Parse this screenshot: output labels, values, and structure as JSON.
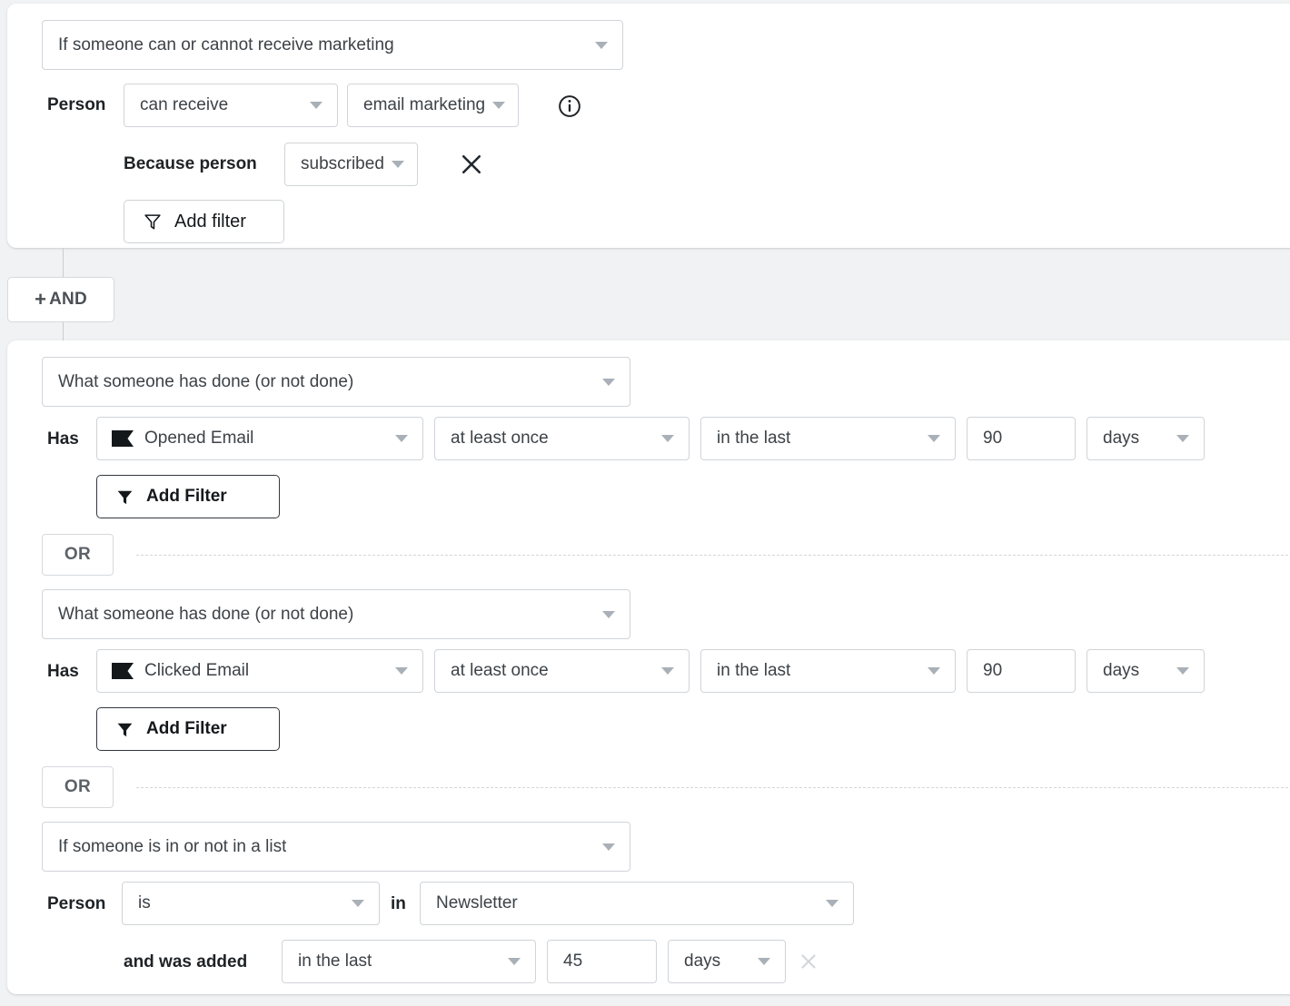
{
  "colors": {
    "page_bg": "#f1f2f3",
    "card_bg": "#ffffff",
    "border": "#d0d4d8",
    "text": "#3d4247",
    "label": "#1f2326",
    "caret": "#a9b0b7",
    "muted": "#5c6268"
  },
  "groups": [
    {
      "condition_type": "If someone can or cannot receive marketing",
      "rows": [
        {
          "label": "Person",
          "operator": "can receive",
          "channel": "email marketing",
          "info_icon": "info-circle-icon"
        },
        {
          "label": "Because person",
          "reason": "subscribed",
          "remove_icon": "close-icon"
        }
      ],
      "add_filter": {
        "label": "Add filter",
        "icon": "funnel-outline-icon"
      }
    }
  ],
  "and_button": {
    "plus": "+",
    "label": "AND"
  },
  "second_group": {
    "blocks": [
      {
        "condition_type": "What someone has done (or not done)",
        "label": "Has",
        "metric": {
          "icon": "email-flag-icon",
          "name": "Opened Email"
        },
        "frequency": "at least once",
        "timeframe": "in the last",
        "amount": "90",
        "unit": "days",
        "add_filter": {
          "label": "Add Filter",
          "icon": "funnel-solid-icon"
        },
        "separator": "OR"
      },
      {
        "condition_type": "What someone has done (or not done)",
        "label": "Has",
        "metric": {
          "icon": "email-flag-icon",
          "name": "Clicked Email"
        },
        "frequency": "at least once",
        "timeframe": "in the last",
        "amount": "90",
        "unit": "days",
        "add_filter": {
          "label": "Add Filter",
          "icon": "funnel-solid-icon"
        },
        "separator": "OR"
      },
      {
        "condition_type": "If someone is in or not in a list",
        "label": "Person",
        "membership": "is",
        "in_label": "in",
        "list_name": "Newsletter",
        "added_label": "and was added",
        "added_timeframe": "in the last",
        "added_amount": "45",
        "added_unit": "days",
        "remove_icon": "close-icon"
      }
    ]
  }
}
